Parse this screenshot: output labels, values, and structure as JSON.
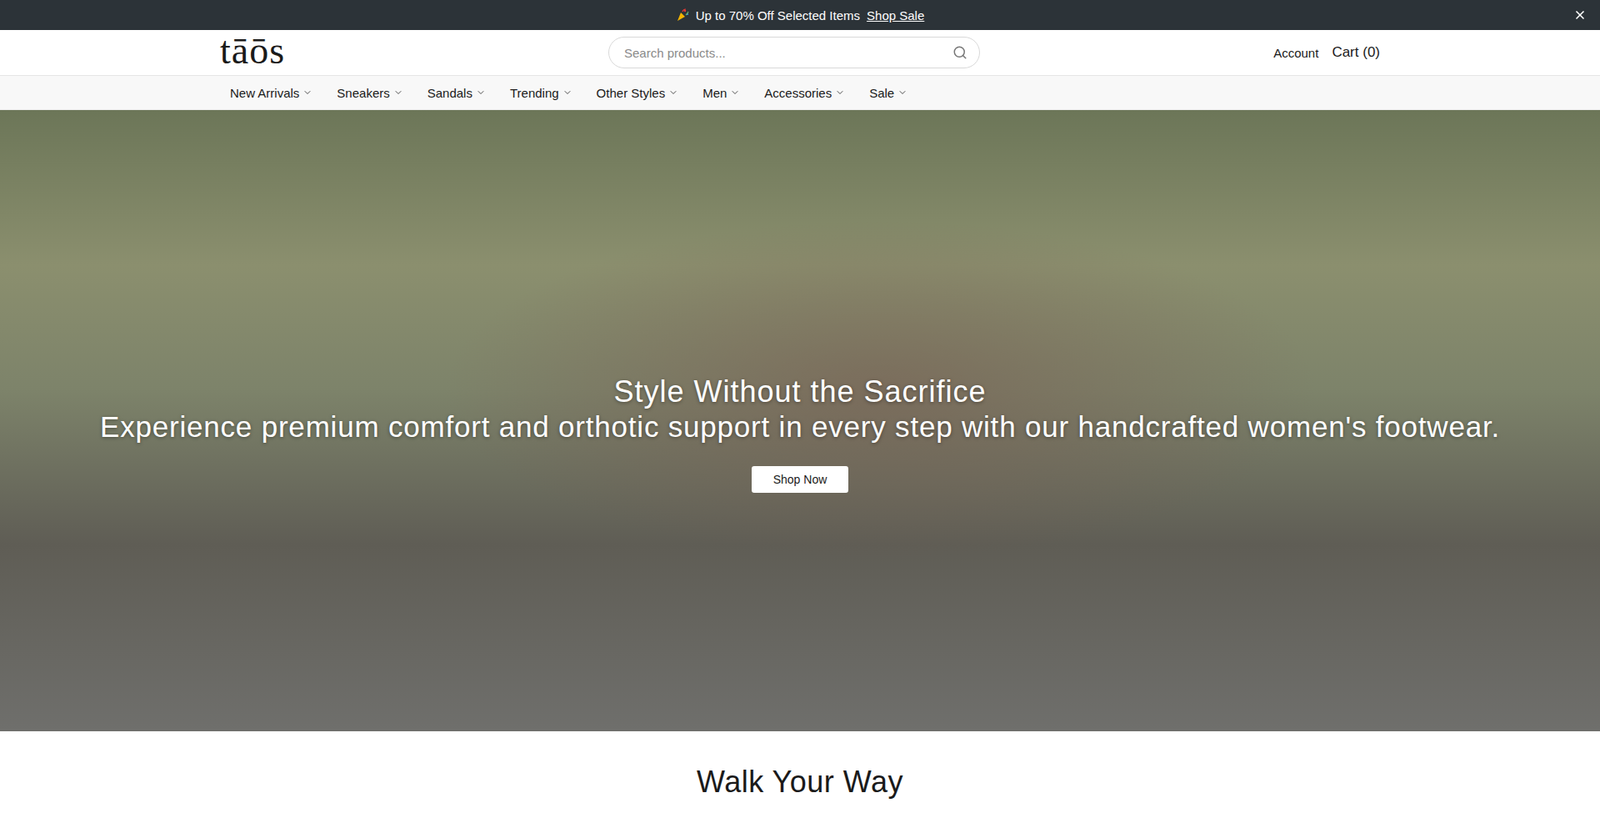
{
  "announcement": {
    "text": "Up to 70% Off Selected Items",
    "link": "Shop Sale"
  },
  "header": {
    "logo": "tāōs",
    "search": {
      "placeholder": "Search products..."
    },
    "account": "Account",
    "cart": "Cart (0)"
  },
  "nav": [
    {
      "label": "New Arrivals"
    },
    {
      "label": "Sneakers"
    },
    {
      "label": "Sandals"
    },
    {
      "label": "Trending"
    },
    {
      "label": "Other Styles"
    },
    {
      "label": "Men"
    },
    {
      "label": "Accessories"
    },
    {
      "label": "Sale"
    }
  ],
  "hero": {
    "title": "Style Without the Sacrifice",
    "subtitle": "Experience premium comfort and orthotic support in every step with our handcrafted women's footwear.",
    "button": "Shop Now"
  },
  "section": {
    "title": "Walk Your Way"
  }
}
